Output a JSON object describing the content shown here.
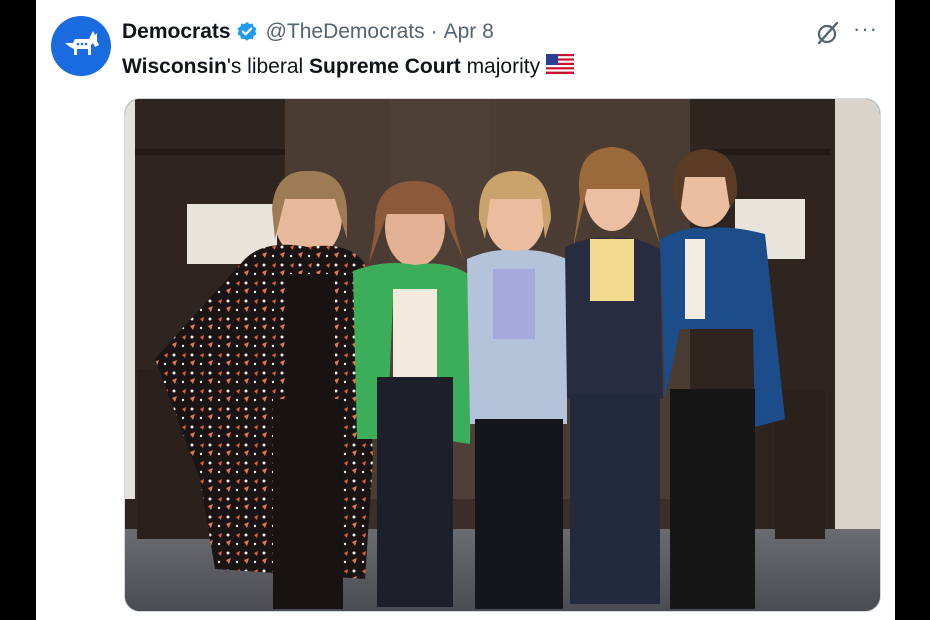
{
  "tweet": {
    "display_name": "Democrats",
    "handle": "@TheDemocrats",
    "separator": "·",
    "date": "Apr 8",
    "text_part1": "Wisconsin",
    "text_part2": "'s liberal ",
    "text_part3": "Supreme Court",
    "text_part4": " majority",
    "flag_emoji": "us-flag-icon"
  },
  "colors": {
    "avatar_bg": "#1a6be0",
    "verified": "#1d9bf0",
    "handle": "#536471",
    "text": "#0f1419"
  },
  "icons": [
    "donkey-logo-icon",
    "verified-badge-icon",
    "grok-icon",
    "more-icon",
    "us-flag-icon"
  ]
}
